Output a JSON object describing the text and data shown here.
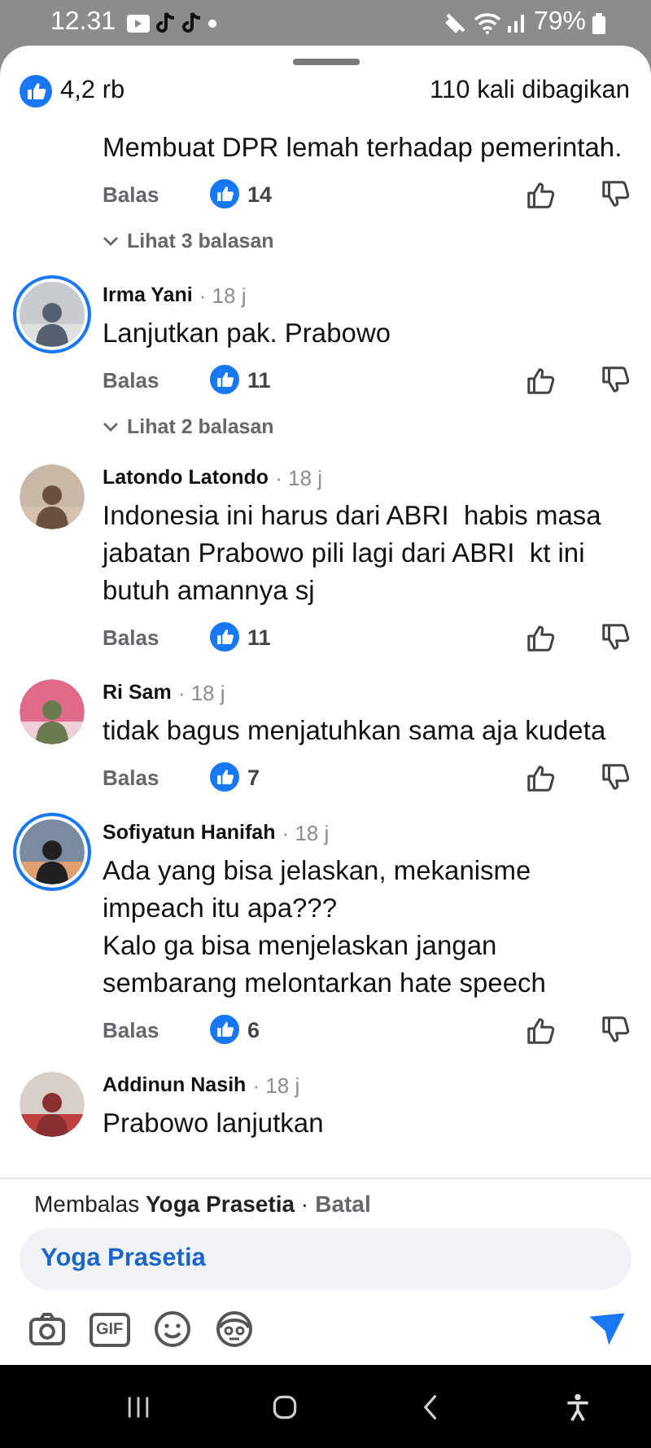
{
  "status_bar": {
    "time": "12.31",
    "battery": "79%"
  },
  "header": {
    "reactions": "4,2 rb",
    "shares": "110 kali dibagikan"
  },
  "comments": [
    {
      "text": "Membuat DPR lemah terhadap pemerintah.",
      "reply": "Balas",
      "likes": "14",
      "replies": "Lihat 3 balasan"
    },
    {
      "author": "Irma Yani",
      "time": "· 18 j",
      "story_ring": true,
      "text": "Lanjutkan pak. Prabowo",
      "reply": "Balas",
      "likes": "11",
      "replies": "Lihat 2 balasan"
    },
    {
      "author": "Latondo Latondo",
      "time": "· 18 j",
      "story_ring": false,
      "text": "Indonesia ini harus dari ABRI  habis masa jabatan Prabowo pili lagi dari ABRI  kt ini butuh amannya sj",
      "reply": "Balas",
      "likes": "11"
    },
    {
      "author": "Ri Sam",
      "time": "· 18 j",
      "story_ring": false,
      "text": "tidak bagus menjatuhkan sama aja kudeta",
      "reply": "Balas",
      "likes": "7"
    },
    {
      "author": "Sofiyatun Hanifah",
      "time": "· 18 j",
      "story_ring": true,
      "text": "Ada yang bisa jelaskan, mekanisme impeach itu apa???\nKalo ga bisa menjelaskan jangan sembarang melontarkan hate speech",
      "reply": "Balas",
      "likes": "6"
    },
    {
      "author": "Addinun Nasih",
      "time": "· 18 j",
      "story_ring": false,
      "text": "Prabowo lanjutkan"
    }
  ],
  "reply_bar": {
    "label": "Membalas **Yoga Prasetia** ·",
    "cancel": "Batal",
    "value": "Yoga Prasetia",
    "gif": "GIF"
  }
}
